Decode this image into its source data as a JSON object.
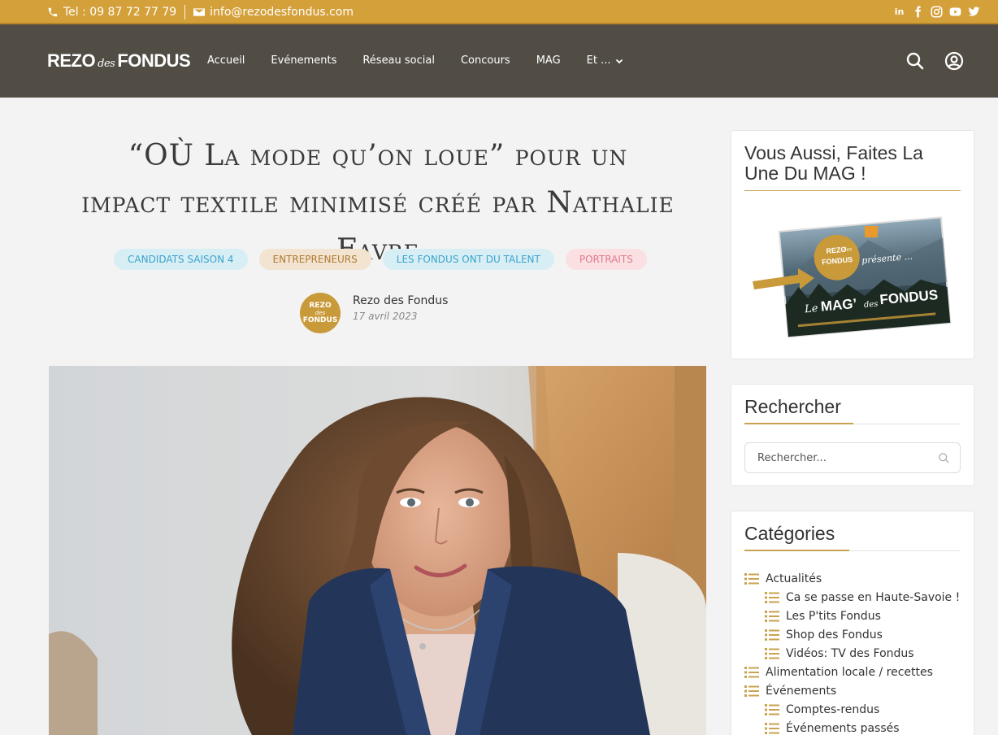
{
  "topbar": {
    "phone": "Tel : 09 87 72 77 79",
    "email": "info@rezodesfondus.com",
    "social": [
      "linkedin-icon",
      "facebook-icon",
      "instagram-icon",
      "youtube-icon",
      "twitter-icon"
    ]
  },
  "header": {
    "logo_left": "REZO",
    "logo_mid": "des",
    "logo_right": "FONDUS",
    "nav": [
      "Accueil",
      "Evénements",
      "Réseau social",
      "Concours",
      "MAG",
      "Et ..."
    ]
  },
  "article": {
    "title": "“OÙ La mode qu’on loue” pour un impact textile minimisé créé par Nathalie Favre",
    "tags": [
      "CANDIDATS SAISON 4",
      "ENTREPRENEURS",
      "LES FONDUS ONT DU TALENT",
      "PORTRAITS"
    ],
    "author": "Rezo des Fondus",
    "date": "17 avril 2023",
    "avatar_top": "REZO",
    "avatar_mid": "des",
    "avatar_bottom": "FONDUS"
  },
  "sidebar": {
    "mag_title": "Vous Aussi, Faites La Une Du MAG !",
    "mag_image": {
      "badge_top": "REZO",
      "badge_mid": "des",
      "badge_bottom": "FONDUS",
      "presente": "présente ...",
      "le": "Le",
      "mag": "MAG’",
      "des": "des",
      "fondus": "FONDUS"
    },
    "search_title": "Rechercher",
    "search_placeholder": "Rechercher...",
    "categories_title": "Catégories",
    "categories": [
      {
        "label": "Actualités",
        "sub": false
      },
      {
        "label": "Ca se passe en Haute-Savoie !",
        "sub": true
      },
      {
        "label": "Les P'tits Fondus",
        "sub": true
      },
      {
        "label": "Shop des Fondus",
        "sub": true
      },
      {
        "label": "Vidéos: TV des Fondus",
        "sub": true
      },
      {
        "label": "Alimentation locale / recettes",
        "sub": false
      },
      {
        "label": "Événements",
        "sub": false
      },
      {
        "label": "Comptes-rendus",
        "sub": true
      },
      {
        "label": "Événements passés",
        "sub": true
      }
    ]
  },
  "colors": {
    "accent": "#d4a03a",
    "header_bg": "#514d45",
    "background": "#f3f3f3"
  }
}
